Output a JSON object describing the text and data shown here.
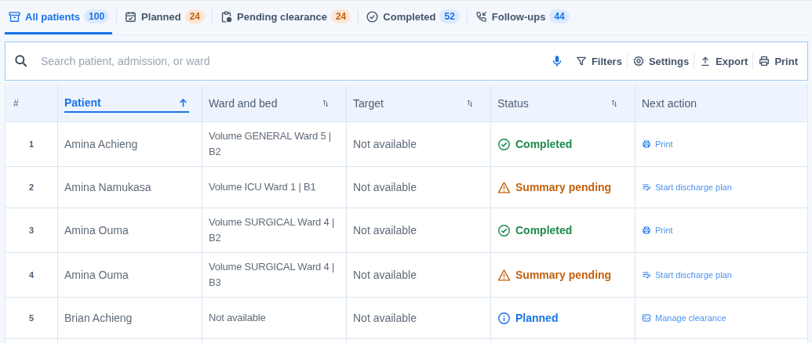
{
  "tabs": [
    {
      "kind": "archive",
      "label": "All patients",
      "count": "100",
      "color": "#dbeafe",
      "selected": true
    },
    {
      "kind": "calendar",
      "label": "Planned",
      "count": "24",
      "color": "#fbe7d4",
      "selected": false
    },
    {
      "kind": "clipboard",
      "label": "Pending clearance",
      "count": "24",
      "color": "#fbe7d4",
      "selected": false
    },
    {
      "kind": "check",
      "label": "Completed",
      "count": "52",
      "color": "#dbeafe",
      "selected": false
    },
    {
      "kind": "phone",
      "label": "Follow-ups",
      "count": "44",
      "color": "#dbeafe",
      "selected": false
    }
  ],
  "search": {
    "placeholder": "Search patient, admission, or ward"
  },
  "toolbar": [
    {
      "kind": "mic"
    },
    {
      "kind": "filter",
      "label": "Filters"
    },
    {
      "kind": "gear",
      "label": "Settings"
    },
    {
      "kind": "upload",
      "label": "Export"
    },
    {
      "kind": "print",
      "label": "Print"
    }
  ],
  "table": {
    "columns": [
      {
        "label": "#",
        "sortable": false,
        "selected": false
      },
      {
        "label": "Patient",
        "sortable": true,
        "selected": true
      },
      {
        "label": "Ward and bed",
        "sortable": true,
        "selected": false
      },
      {
        "label": "Target",
        "sortable": true,
        "selected": false
      },
      {
        "label": "Status",
        "sortable": true,
        "selected": false
      },
      {
        "label": "Next action",
        "sortable": false,
        "selected": false
      }
    ],
    "rows": [
      {
        "index": "1",
        "patient": "Amina Achieng",
        "ward": "Volume GENERAL Ward 5 | B2",
        "target": "Not available",
        "status": {
          "kind": "completed",
          "label": "Completed"
        },
        "action": {
          "kind": "print",
          "label": "Print"
        }
      },
      {
        "index": "2",
        "patient": "Amina Namukasa",
        "ward": "Volume ICU Ward 1 | B1",
        "target": "Not available",
        "status": {
          "kind": "pending",
          "label": "Summary pending"
        },
        "action": {
          "kind": "plan",
          "label": "Start discharge plan"
        }
      },
      {
        "index": "3",
        "patient": "Amina Ouma",
        "ward": "Volume SURGICAL Ward 4 | B2",
        "target": "Not available",
        "status": {
          "kind": "completed",
          "label": "Completed"
        },
        "action": {
          "kind": "print",
          "label": "Print"
        }
      },
      {
        "index": "4",
        "patient": "Amina Ouma",
        "ward": "Volume SURGICAL Ward 4 | B3",
        "target": "Not available",
        "status": {
          "kind": "pending",
          "label": "Summary pending"
        },
        "action": {
          "kind": "plan",
          "label": "Start discharge plan"
        }
      },
      {
        "index": "5",
        "patient": "Brian Achieng",
        "ward": "Not available",
        "target": "Not available",
        "status": {
          "kind": "planned",
          "label": "Planned"
        },
        "action": {
          "kind": "clearance",
          "label": "Manage clearance"
        }
      }
    ]
  }
}
